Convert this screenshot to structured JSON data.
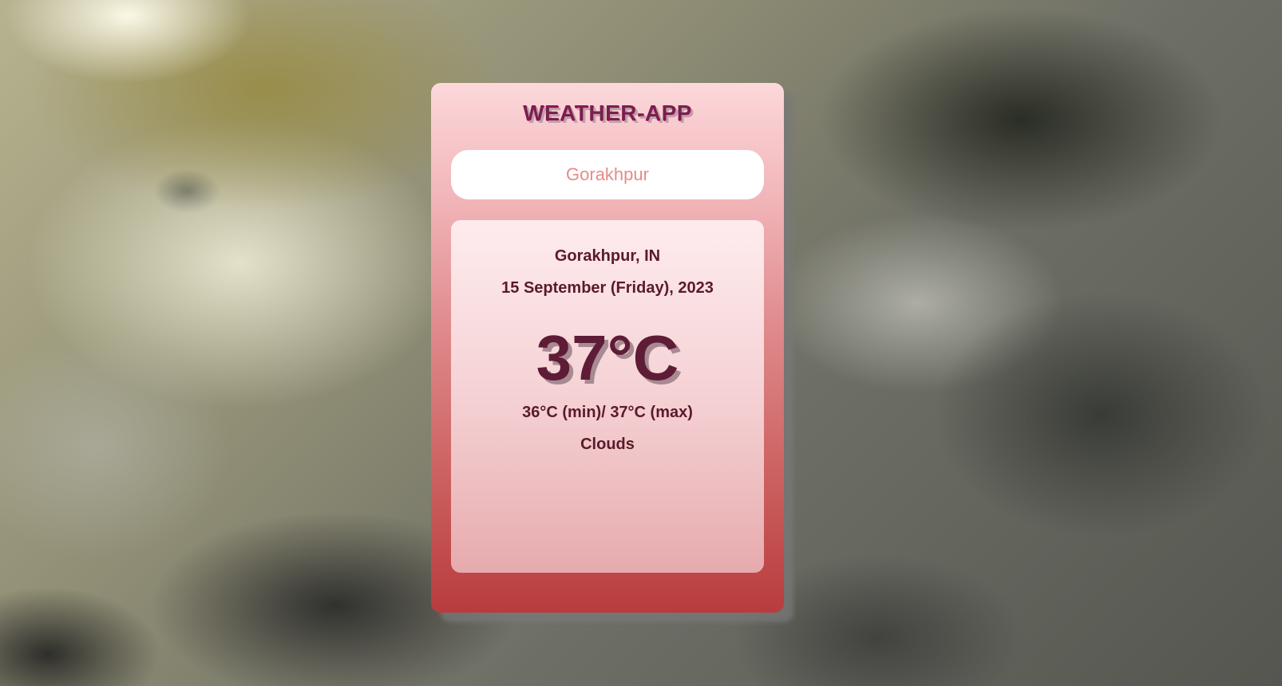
{
  "app": {
    "title": "WEATHER-APP"
  },
  "search": {
    "value": "Gorakhpur",
    "placeholder": ""
  },
  "weather": {
    "location": "Gorakhpur, IN",
    "date": "15 September (Friday), 2023",
    "temperature": "37°C",
    "min_max": "36°C (min)/ 37°C (max)",
    "condition": "Clouds"
  },
  "colors": {
    "card_top": "#fcd8db",
    "card_bottom": "#b83c3d",
    "title_text": "#7a1f4e",
    "primary_text": "#5a1a2c",
    "input_text": "#e88a8a"
  }
}
